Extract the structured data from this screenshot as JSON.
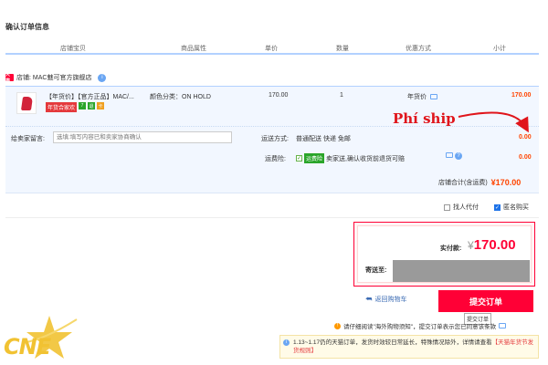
{
  "page_title": "确认订单信息",
  "columns": [
    "店铺宝贝",
    "商品属性",
    "单价",
    "数量",
    "优惠方式",
    "小计"
  ],
  "shop": {
    "badge": "天猫",
    "name": "店铺: MAC魅可官方旗舰店",
    "info_icon": "i"
  },
  "item": {
    "title": "【年货价】【官方正品】MAC/...",
    "tag_red": "年货合家欢",
    "tag_green": "7",
    "tag_icon2": "退",
    "tag_icon3": "卡",
    "color": "颜色分类：ON HOLD",
    "price": "170.00",
    "qty": "1",
    "promo": "年货价",
    "subtotal": "170.00"
  },
  "message": {
    "label": "给卖家留言:",
    "placeholder": "选填:填写内容已和卖家协商确认"
  },
  "shipping": {
    "label": "运送方式:",
    "value": "普通配送 快递 免邮",
    "price": "0.00"
  },
  "insurance": {
    "label": "运费险:",
    "badge": "运费险",
    "text": "卖家送,确认收货前退货可赔",
    "price": "0.00"
  },
  "shop_total": {
    "label": "店铺合计(含运费)",
    "amount": "¥170.00"
  },
  "options": {
    "proxy_pay": "找人代付",
    "anonymous": "匿名购买"
  },
  "pay": {
    "label": "实付款:",
    "currency": "¥",
    "amount": "170.00",
    "address_label": "寄送至:"
  },
  "back_cart": "返回购物车",
  "submit": "提交订单",
  "submit_tip": "提交订单",
  "notice1": "请仔细阅读\"海外购物须知\"，提交订单表示您已同意该条款",
  "notice2_a": "1.13~1.17仍的天猫订单，发货时效较日常延长，特殊情况除外，详情请查看",
  "notice2_b": "【天猫年货节发货规则】",
  "annotation": "Phí ship",
  "logo_text": "CNE",
  "colors": {
    "accent_red": "#ff0036",
    "price_orange": "#ff4400",
    "header_blue": "#b2d1ff",
    "row_bg": "#f2f7ff",
    "logo_gold": "#f1c232"
  }
}
